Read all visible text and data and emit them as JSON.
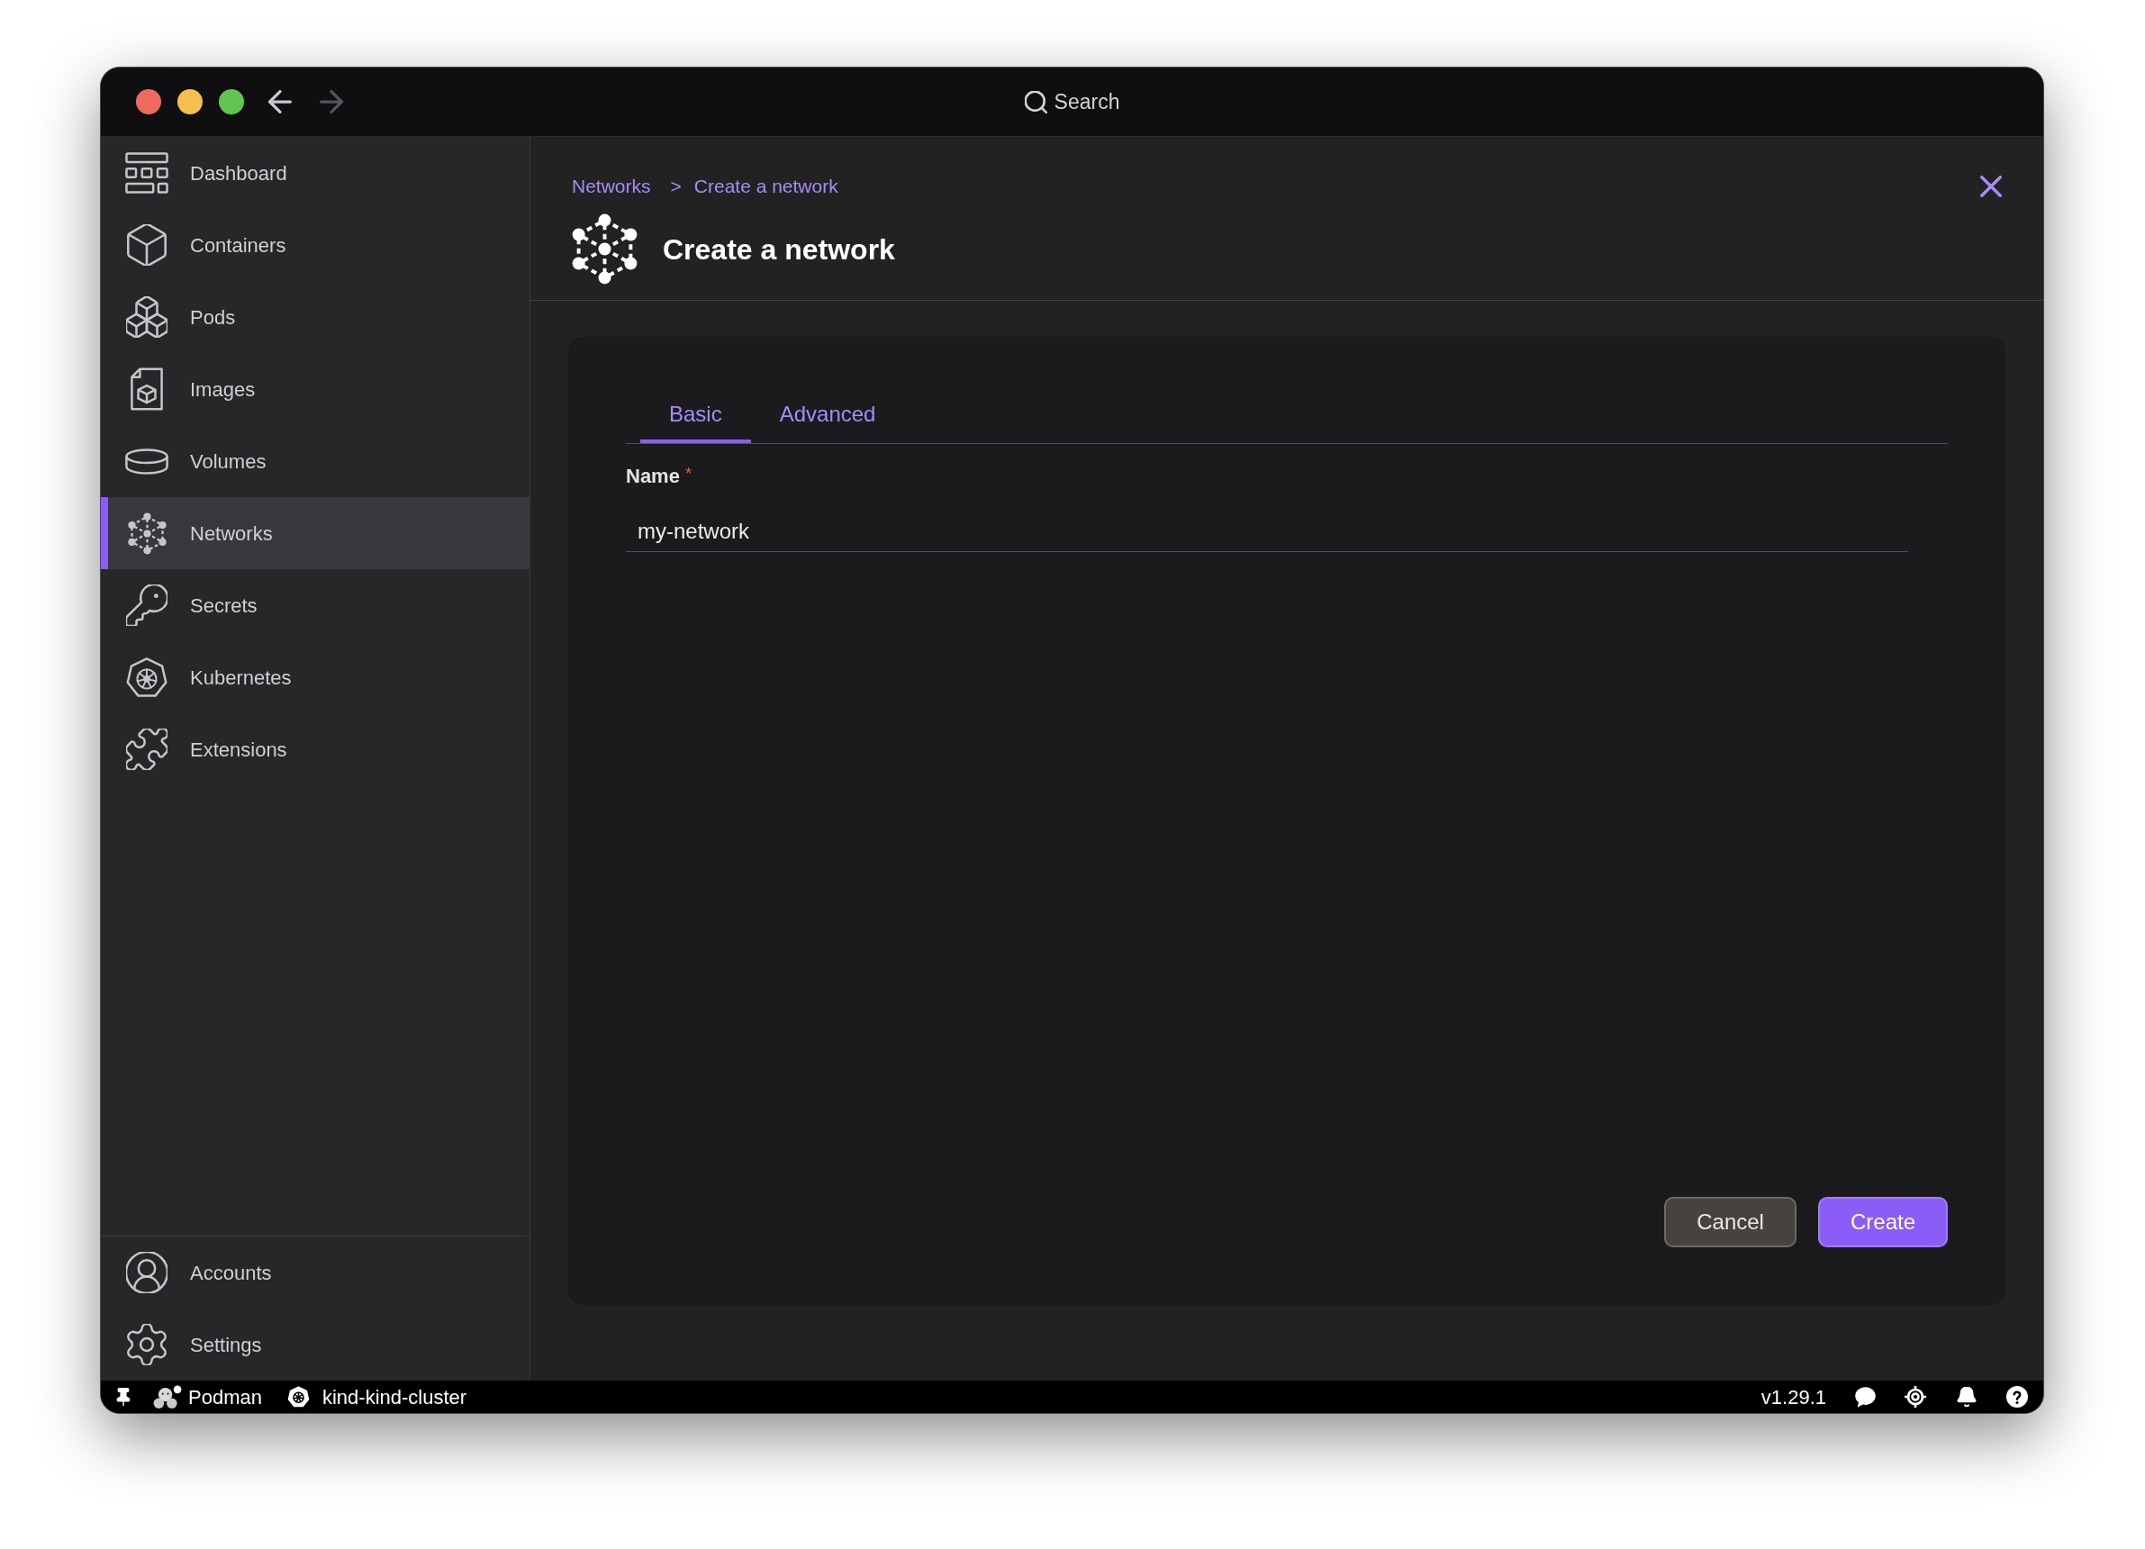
{
  "titlebar": {
    "back": {
      "disabled": false
    },
    "forward": {
      "disabled": true
    },
    "search": {
      "label": "Search"
    }
  },
  "sidebar": {
    "items": [
      {
        "kind": "dashboard",
        "label": "Dashboard",
        "selected": false
      },
      {
        "kind": "containers",
        "label": "Containers",
        "selected": false
      },
      {
        "kind": "pods",
        "label": "Pods",
        "selected": false
      },
      {
        "kind": "images",
        "label": "Images",
        "selected": false
      },
      {
        "kind": "volumes",
        "label": "Volumes",
        "selected": false
      },
      {
        "kind": "networks",
        "label": "Networks",
        "selected": true
      },
      {
        "kind": "secrets",
        "label": "Secrets",
        "selected": false
      },
      {
        "kind": "kubernetes",
        "label": "Kubernetes",
        "selected": false
      },
      {
        "kind": "extensions",
        "label": "Extensions",
        "selected": false
      }
    ],
    "footer_items": [
      {
        "kind": "accounts",
        "label": "Accounts",
        "selected": false
      },
      {
        "kind": "settings",
        "label": "Settings",
        "selected": false
      }
    ]
  },
  "header": {
    "breadcrumb": {
      "parent": "Networks",
      "separator": ">",
      "current": "Create a network"
    },
    "title": "Create a network"
  },
  "form": {
    "tabs": [
      {
        "label": "Basic",
        "selected": true
      },
      {
        "label": "Advanced",
        "selected": false
      }
    ],
    "fields": [
      {
        "label": "Name",
        "required_mark": "*",
        "value": "my-network"
      }
    ],
    "buttons": [
      {
        "kind": "secondary",
        "label": "Cancel"
      },
      {
        "kind": "primary",
        "label": "Create"
      }
    ]
  },
  "status_bar": {
    "provider": {
      "label": "Podman"
    },
    "context": {
      "label": "kind-kind-cluster"
    },
    "version": "v1.29.1"
  }
}
